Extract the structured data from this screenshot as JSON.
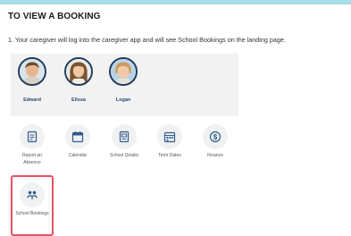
{
  "heading": "TO VIEW A BOOKING",
  "instruction": "1. Your caregiver will log into the caregiver app and will see School Bookings on the landing page.",
  "children": [
    {
      "name": "Edward"
    },
    {
      "name": "Elissa"
    },
    {
      "name": "Logan"
    }
  ],
  "menu": [
    {
      "label": "Report an Absence",
      "icon": "report-absence-icon"
    },
    {
      "label": "Calendar",
      "icon": "calendar-icon"
    },
    {
      "label": "School Details",
      "icon": "school-details-icon"
    },
    {
      "label": "Term Dates",
      "icon": "term-dates-icon"
    },
    {
      "label": "Finance",
      "icon": "finance-icon"
    },
    {
      "label": "School Bookings",
      "icon": "school-bookings-icon"
    }
  ],
  "colors": {
    "top_bar": "#a8dce8",
    "avatar_ring": "#1f3a5e",
    "child_name": "#2c4a73",
    "icon": "#2f5a8a",
    "highlight": "#e45263",
    "panel_bg": "#f2f2f3"
  }
}
